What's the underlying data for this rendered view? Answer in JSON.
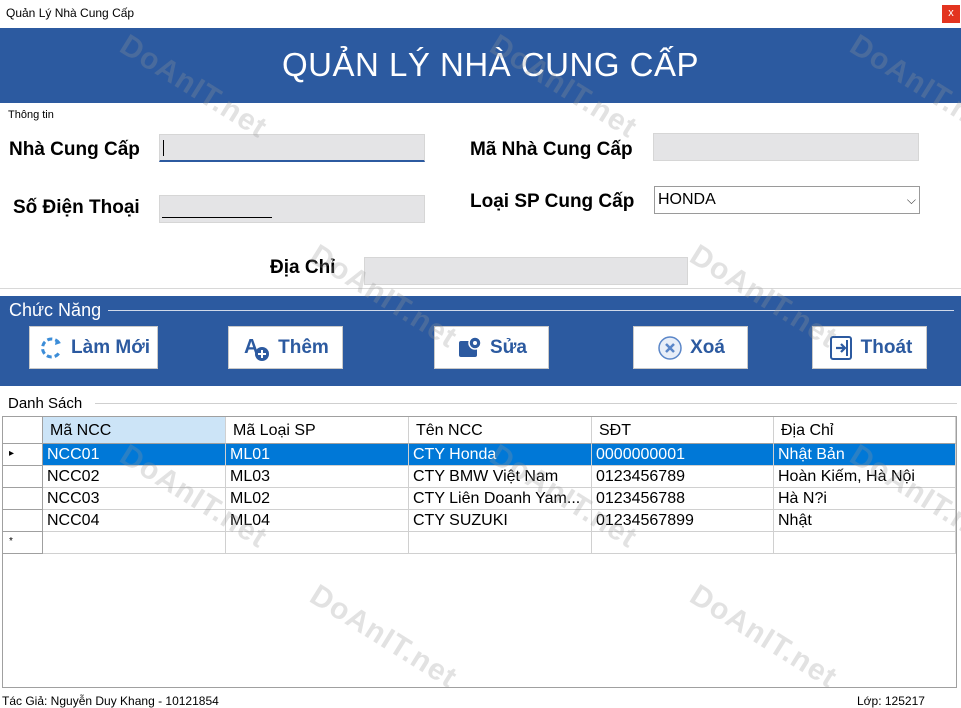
{
  "window": {
    "title": "Quản Lý Nhà Cung Cấp",
    "close_label": "x"
  },
  "header": {
    "heading": "QUẢN LÝ NHÀ CUNG CẤP"
  },
  "info": {
    "group_label": "Thông tin",
    "supplier_name_label": "Nhà Cung Cấp",
    "supplier_name_value": "",
    "supplier_code_label": "Mã Nhà Cung Cấp",
    "supplier_code_value": "",
    "phone_label": "Số Điện Thoại",
    "phone_value": "",
    "product_type_label": "Loại SP Cung Cấp",
    "product_type_value": "HONDA",
    "address_label": "Địa Chỉ",
    "address_value": ""
  },
  "functions": {
    "group_label": "Chức Năng",
    "buttons": [
      {
        "label": "Làm Mới",
        "icon": "refresh-icon"
      },
      {
        "label": "Thêm",
        "icon": "add-icon"
      },
      {
        "label": "Sửa",
        "icon": "edit-icon"
      },
      {
        "label": "Xoá",
        "icon": "delete-icon"
      },
      {
        "label": "Thoát",
        "icon": "exit-icon"
      }
    ]
  },
  "list": {
    "group_label": "Danh Sách",
    "columns": [
      "Mã NCC",
      "Mã Loại SP",
      "Tên NCC",
      "SĐT",
      "Địa Chỉ"
    ],
    "rows": [
      [
        "NCC01",
        "ML01",
        "CTY Honda",
        "0000000001",
        "Nhật Bản"
      ],
      [
        "NCC02",
        "ML03",
        "CTY BMW Việt Nam",
        "0123456789",
        "Hoàn Kiếm, Hà Nội"
      ],
      [
        "NCC03",
        "ML02",
        "CTY Liên Doanh Yam...",
        "0123456788",
        "Hà N?i"
      ],
      [
        "NCC04",
        "ML04",
        "CTY SUZUKI",
        "01234567899",
        "Nhật"
      ]
    ],
    "selected_row_marker": "▸",
    "new_row_marker": "*"
  },
  "footer": {
    "author": "Tác Giả: Nguyễn Duy Khang - 10121854",
    "class": "Lớp: 125217"
  },
  "watermark_text": "DoAnIT.net",
  "colors": {
    "brand_blue": "#2c5aa0",
    "selection": "#0078d7",
    "close_red": "#e3341f"
  }
}
